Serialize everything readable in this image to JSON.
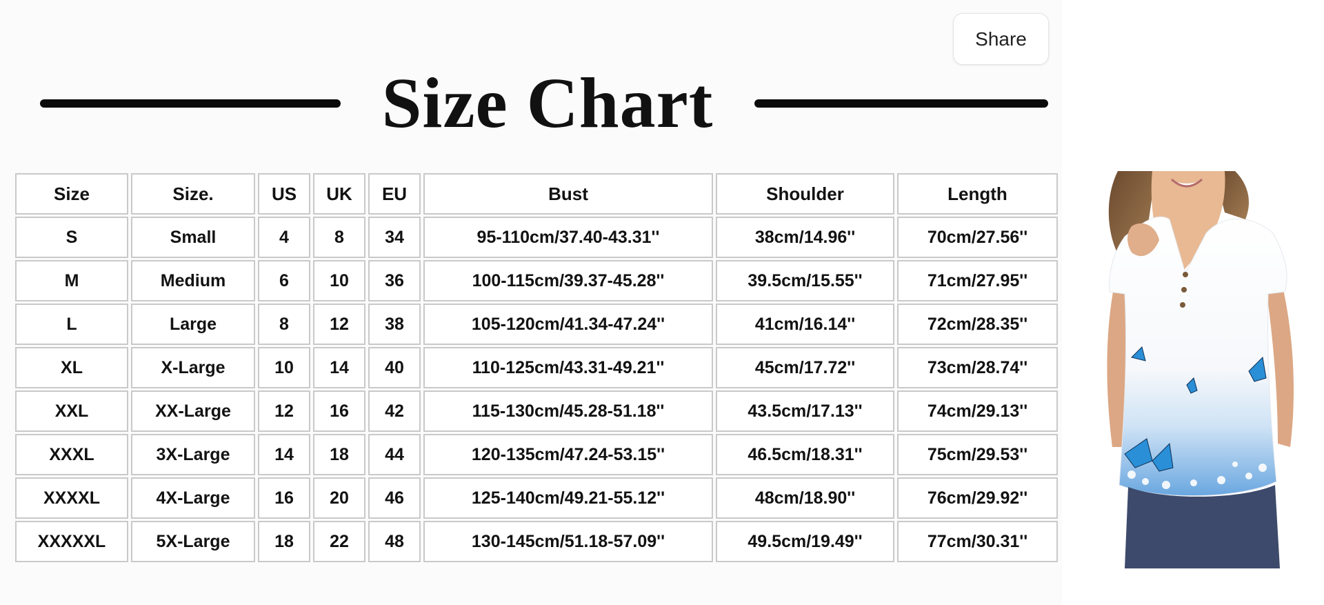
{
  "share": {
    "label": "Share"
  },
  "title": "Size Chart",
  "table": {
    "headers": [
      "Size",
      "Size.",
      "US",
      "UK",
      "EU",
      "Bust",
      "Shoulder",
      "Length"
    ],
    "rows": [
      [
        "S",
        "Small",
        "4",
        "8",
        "34",
        "95-110cm/37.40-43.31''",
        "38cm/14.96''",
        "70cm/27.56''"
      ],
      [
        "M",
        "Medium",
        "6",
        "10",
        "36",
        "100-115cm/39.37-45.28''",
        "39.5cm/15.55''",
        "71cm/27.95''"
      ],
      [
        "L",
        "Large",
        "8",
        "12",
        "38",
        "105-120cm/41.34-47.24''",
        "41cm/16.14''",
        "72cm/28.35''"
      ],
      [
        "XL",
        "X-Large",
        "10",
        "14",
        "40",
        "110-125cm/43.31-49.21''",
        "45cm/17.72''",
        "73cm/28.74''"
      ],
      [
        "XXL",
        "XX-Large",
        "12",
        "16",
        "42",
        "115-130cm/45.28-51.18''",
        "43.5cm/17.13''",
        "74cm/29.13''"
      ],
      [
        "XXXL",
        "3X-Large",
        "14",
        "18",
        "44",
        "120-135cm/47.24-53.15''",
        "46.5cm/18.31''",
        "75cm/29.53''"
      ],
      [
        "XXXXL",
        "4X-Large",
        "16",
        "20",
        "46",
        "125-140cm/49.21-55.12''",
        "48cm/18.90''",
        "76cm/29.92''"
      ],
      [
        "XXXXXL",
        "5X-Large",
        "18",
        "22",
        "48",
        "130-145cm/51.18-57.09''",
        "49.5cm/19.49''",
        "77cm/30.31''"
      ]
    ]
  },
  "colors": {
    "rule": "#0b0b0b",
    "cell_border": "#c9c9c9",
    "butterfly_blue": "#2a8fd6"
  },
  "icons": {
    "share": "share-button"
  }
}
